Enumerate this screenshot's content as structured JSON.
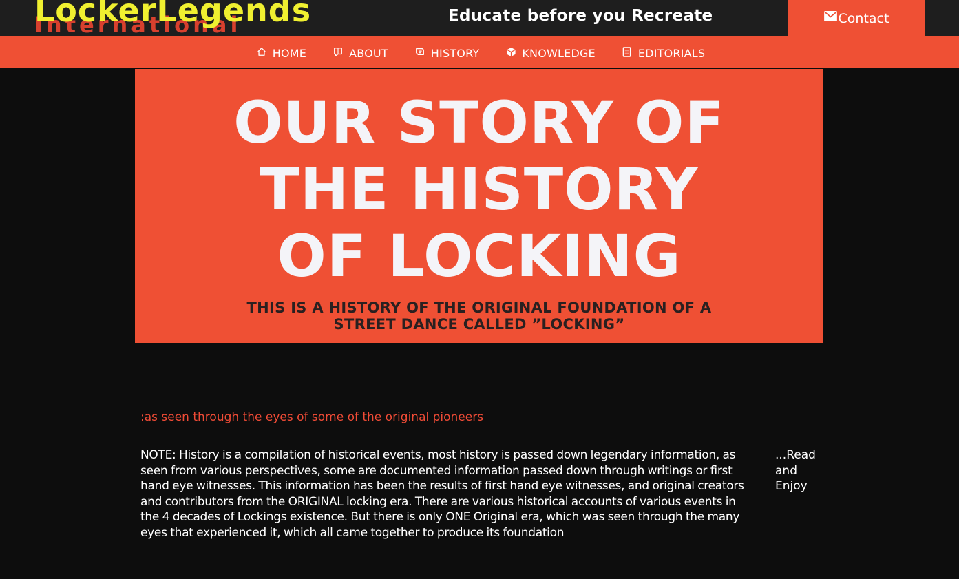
{
  "header": {
    "logo_main": "LockerLegends",
    "logo_sub": "International",
    "tagline": "Educate before you Recreate",
    "contact_label": "Contact",
    "colors": {
      "header_bg": "#1e1e1e",
      "accent": "#ef5034",
      "logo_yellow": "#f0f030"
    }
  },
  "nav": {
    "items": [
      {
        "label": "HOME",
        "icon": "home-icon"
      },
      {
        "label": "ABOUT",
        "icon": "book-icon"
      },
      {
        "label": "HISTORY",
        "icon": "history-icon"
      },
      {
        "label": "KNOWLEDGE",
        "icon": "cube-icon"
      },
      {
        "label": "EDITORIALS",
        "icon": "document-icon"
      }
    ]
  },
  "hero": {
    "title_line1": "OUR STORY OF",
    "title_line2": "THE HISTORY",
    "title_line3": "OF LOCKING",
    "subtitle": "THIS IS A HISTORY OF THE ORIGINAL FOUNDATION OF A STREET DANCE CALLED ”LOCKING”"
  },
  "main": {
    "eyes_line": ":as seen through the eyes of some of the original pioneers",
    "note": "NOTE: History is a compilation of historical events, most history is passed down legendary information, as seen from various perspectives, some are documented information passed down through writings or first hand eye witnesses. This information has been the results of first hand eye witnesses, and original creators and contributors from the ORIGINAL locking era. There are various historical accounts of various events in the 4 decades of Lockings existence. But there is only ONE Original era, which was seen through the many eyes that experienced it, which all came together to produce its foundation",
    "read_enjoy": "...Read and Enjoy"
  }
}
